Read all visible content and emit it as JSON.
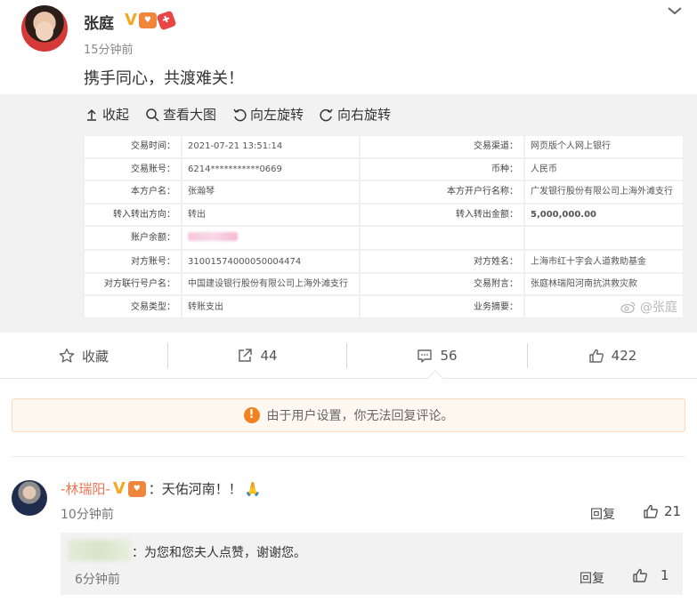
{
  "post": {
    "user_name": "张庭",
    "verified_mark": "V",
    "time": "15分钟前",
    "text": "携手同心，共渡难关！"
  },
  "toolbar": {
    "collapse": "收起",
    "view_large": "查看大图",
    "rotate_left": "向左旋转",
    "rotate_right": "向右旋转"
  },
  "receipt": {
    "rows": [
      {
        "k1": "交易时间：",
        "v1": "2021-07-21 13:51:14",
        "k2": "交易渠道：",
        "v2": "网页版个人网上银行"
      },
      {
        "k1": "交易账号：",
        "v1": "6214***********0669",
        "k2": "币种：",
        "v2": "人民币"
      },
      {
        "k1": "本方户名：",
        "v1": "张瀚琴",
        "k2": "本方开户行名称：",
        "v2": "广发银行股份有限公司上海外滩支行"
      },
      {
        "k1": "转入转出方向：",
        "v1": "转出",
        "k2": "转入转出金额：",
        "v2": "5,000,000.00"
      },
      {
        "k1": "账户余额：",
        "v1": "",
        "k2": "",
        "v2": ""
      },
      {
        "k1": "对方账号：",
        "v1": "31001574000050004474",
        "k2": "对方姓名：",
        "v2": "上海市红十字会人道救助基金"
      },
      {
        "k1": "对方联行号户名：",
        "v1": "中国建设银行股份有限公司上海外滩支行",
        "k2": "交易附言：",
        "v2": "张庭林瑞阳河南抗洪救灾款"
      },
      {
        "k1": "交易类型：",
        "v1": "转账支出",
        "k2": "业务摘要：",
        "v2": ""
      }
    ],
    "watermark": "@张庭"
  },
  "actions": {
    "favorite": "收藏",
    "share_count": "44",
    "comment_count": "56",
    "like_count": "422"
  },
  "notice": {
    "text": "由于用户设置，你无法回复评论。"
  },
  "comment": {
    "user_name": "-林瑞阳-",
    "verified_mark": "V",
    "text": "：天佑河南！！",
    "emoji": "🙏",
    "time": "10分钟前",
    "reply": "回复",
    "like_count": "21"
  },
  "subcomment": {
    "text": "：为您和您夫人点赞，谢谢您。",
    "time": "6分钟前",
    "reply": "回复",
    "like_count": "1"
  },
  "colors": {
    "link_orange": "#eb7350",
    "warning_orange": "#f48120",
    "amount_green": "#2e8b3a",
    "vip_gold": "#f5a623"
  }
}
